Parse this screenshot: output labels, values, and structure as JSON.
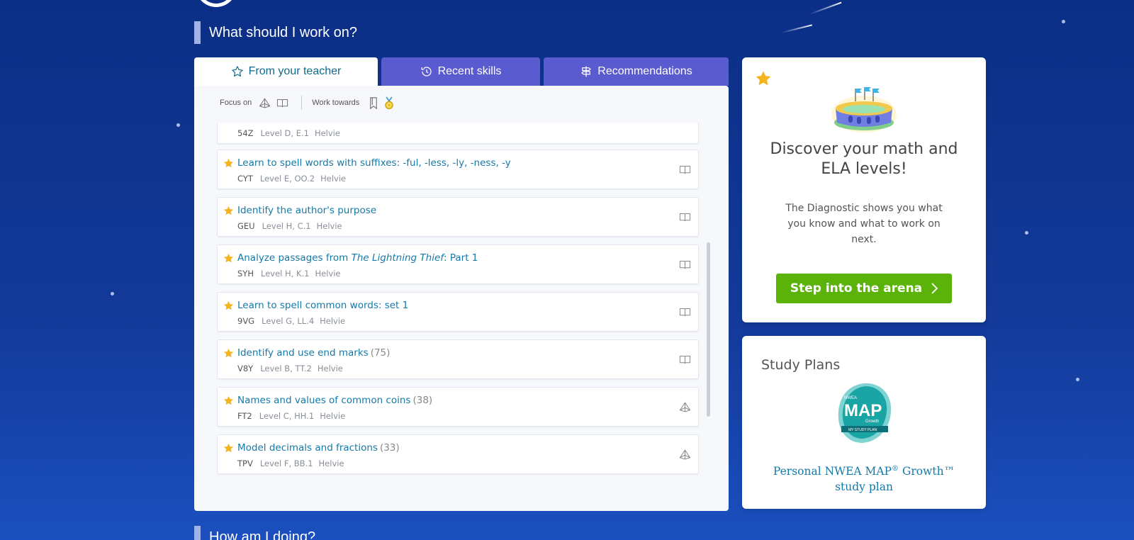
{
  "colors": {
    "background": "#0b2f86",
    "tab_inactive": "#5b5bd0",
    "link": "#1579a8",
    "star": "#f5b31c",
    "cta": "#5bb30a"
  },
  "headings": {
    "work_on": "What should I work on?",
    "how_doing": "How am I doing?"
  },
  "tabs": [
    {
      "label": "From your teacher",
      "icon": "star-outline-icon",
      "active": true
    },
    {
      "label": "Recent skills",
      "icon": "history-icon",
      "active": false
    },
    {
      "label": "Recommendations",
      "icon": "signpost-icon",
      "active": false
    }
  ],
  "toolbar": {
    "focus_label": "Focus on",
    "work_towards_label": "Work towards",
    "icons": [
      "math-pyramid-icon",
      "book-icon",
      "bookmark-icon",
      "medal-icon"
    ]
  },
  "skills": [
    {
      "title": "",
      "count": "",
      "code": "54Z",
      "level": "Level D, E.1",
      "source": "Helvie",
      "type": "math-pyramid-icon"
    },
    {
      "title": "Learn to spell words with suffixes: -ful, -less, -ly, -ness, -y",
      "count": "",
      "code": "CYT",
      "level": "Level E, OO.2",
      "source": "Helvie",
      "type": "book-icon"
    },
    {
      "title": "Identify the author's purpose",
      "count": "",
      "code": "GEU",
      "level": "Level H, C.1",
      "source": "Helvie",
      "type": "book-icon"
    },
    {
      "title_pre": "Analyze passages from ",
      "title_em": "The Lightning Thief",
      "title_post": ": Part 1",
      "count": "",
      "code": "SYH",
      "level": "Level H, K.1",
      "source": "Helvie",
      "type": "book-icon"
    },
    {
      "title": "Learn to spell common words: set 1",
      "count": "",
      "code": "9VG",
      "level": "Level G, LL.4",
      "source": "Helvie",
      "type": "book-icon"
    },
    {
      "title": "Identify and use end marks",
      "count": "(75)",
      "code": "V8Y",
      "level": "Level B, TT.2",
      "source": "Helvie",
      "type": "book-icon"
    },
    {
      "title": "Names and values of common coins",
      "count": "(38)",
      "code": "FT2",
      "level": "Level C, HH.1",
      "source": "Helvie",
      "type": "math-pyramid-icon"
    },
    {
      "title": "Model decimals and fractions",
      "count": "(33)",
      "code": "TPV",
      "level": "Level F, BB.1",
      "source": "Helvie",
      "type": "math-pyramid-icon"
    }
  ],
  "diagnostic": {
    "title_line1": "Discover your math and",
    "title_line2": "ELA levels!",
    "body": "The Diagnostic shows you what you know and what to work on next.",
    "button_label": "Step into the arena"
  },
  "study_plans": {
    "title": "Study Plans",
    "logo_text_small": "NWEA",
    "logo_text_big": "MAP",
    "logo_text_growth": "Growth",
    "logo_text_band": "MY STUDY PLAN",
    "link_line1_pre": "Personal NWEA MAP",
    "link_reg": "®",
    "link_line1_post": " Growth™",
    "link_line2": "study plan"
  }
}
